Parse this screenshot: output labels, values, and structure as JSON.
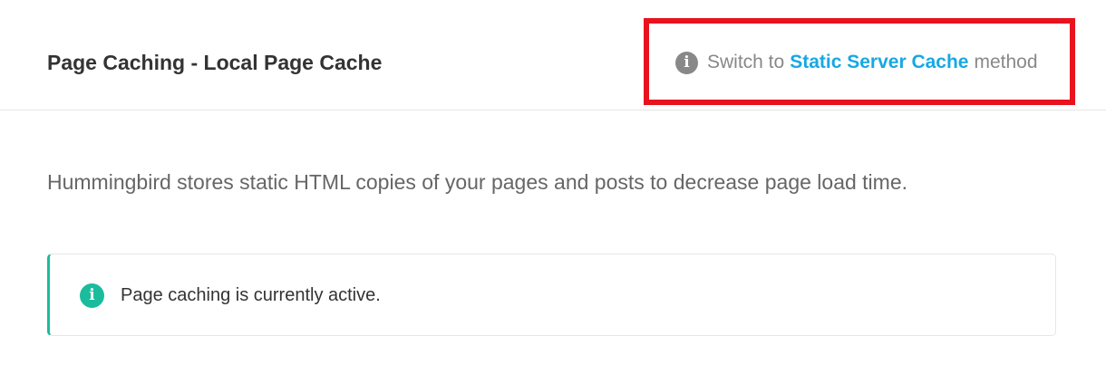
{
  "header": {
    "title": "Page Caching - Local Page Cache",
    "switch": {
      "icon": "info-icon",
      "prefix": "Switch to",
      "link_label": "Static Server Cache",
      "suffix": "method",
      "link_color": "#17a8e3",
      "highlight_color": "#e8131e"
    }
  },
  "main": {
    "description": "Hummingbird stores static HTML copies of your pages and posts to decrease page load time.",
    "notice": {
      "icon": "info-icon",
      "text": "Page caching is currently active.",
      "accent_color": "#1abc9c"
    }
  }
}
